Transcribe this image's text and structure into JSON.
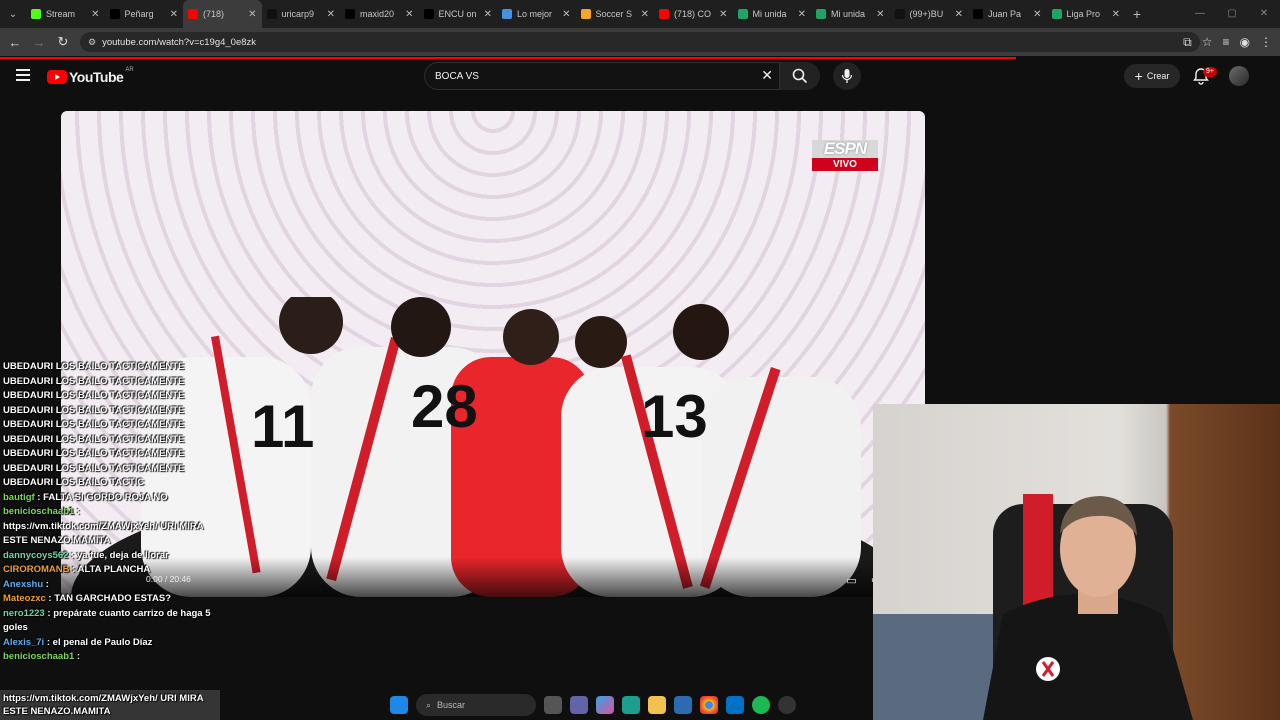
{
  "browser": {
    "tabs": [
      {
        "label": "Stream",
        "icon": "kick-icon",
        "color": "#53fc18"
      },
      {
        "label": "Peñarg",
        "icon": "x-icon",
        "color": "#000000"
      },
      {
        "label": "(718)",
        "icon": "youtube-icon",
        "color": "#ff0000",
        "active": true
      },
      {
        "label": "uricarp9",
        "icon": "tiktok-icon",
        "color": "#111111"
      },
      {
        "label": "maxid20",
        "icon": "x-icon",
        "color": "#000000"
      },
      {
        "label": "ENCU on",
        "icon": "x-icon",
        "color": "#000000"
      },
      {
        "label": "Lo mejor",
        "icon": "bookmark-icon",
        "color": "#4a90e2"
      },
      {
        "label": "Soccer S",
        "icon": "soccer-icon",
        "color": "#f5a623"
      },
      {
        "label": "(718) CO",
        "icon": "youtube-icon",
        "color": "#ff0000"
      },
      {
        "label": "Mi unida",
        "icon": "drive-icon",
        "color": "#1fa463"
      },
      {
        "label": "Mi unida",
        "icon": "drive-icon",
        "color": "#1fa463"
      },
      {
        "label": "(99+)BU",
        "icon": "tiktok-icon",
        "color": "#111111"
      },
      {
        "label": "Juan Pa",
        "icon": "x-icon",
        "color": "#000000"
      },
      {
        "label": "Liga Pro",
        "icon": "globe-icon",
        "color": "#1fa463"
      }
    ],
    "url": "youtube.com/watch?v=c19g4_0e8zk"
  },
  "youtube": {
    "logo_text": "YouTube",
    "country_code": "AR",
    "search_query": "BOCA VS",
    "create_label": "Crear",
    "notification_badge": "9+"
  },
  "video": {
    "channel_logo_text": "ESPN",
    "live_label": "VIVO",
    "time": "0:00 / 20:46"
  },
  "chat": {
    "spam_lines": [
      "UBEDAURI LOS BAILO TACTICAMENTE",
      "UBEDAURI LOS BAILO TACTICAMENTE",
      "UBEDAURI LOS BAILO TACTICAMENTE",
      "UBEDAURI LOS BAILO TACTICAMENTE",
      "UBEDAURI LOS BAILO TACTICAMENTE",
      "UBEDAURI LOS BAILO TACTICAMENTE",
      "UBEDAURI LOS BAILO TACTICAMENTE",
      "UBEDAURI LOS BAILO TACTICAMENTE",
      "UBEDAURI LOS BAILO TACTIC"
    ],
    "messages": [
      {
        "user": "bautigf",
        "color": "#7cd957",
        "text": "FALTA SI GORDO ROJA NO"
      },
      {
        "user": "benicioschaab1",
        "color": "#7cd957",
        "text": "https://vm.tiktok.com/ZMAWjxYeh/ URI MIRA ESTE NENAZO.MAMITA"
      },
      {
        "user": "dannycoys562",
        "color": "#6fd6a0",
        "text": "ya fue, deja de llorar"
      },
      {
        "user": "CIROROMANB",
        "color": "#f0a030",
        "text": "ALTA PLANCHA"
      },
      {
        "user": "Anexshu",
        "color": "#5ab0f0",
        "text": ""
      },
      {
        "user": "Mateozxc",
        "color": "#f0a030",
        "text": "TAN GARCHADO ESTAS?"
      },
      {
        "user": "nero1223",
        "color": "#6fd6a0",
        "text": "prepárate cuanto carrizo de haga 5 goles"
      },
      {
        "user": "Alexis_7i",
        "color": "#5ab0f0",
        "text": "el penal de Paulo Díaz"
      },
      {
        "user": "benicioschaab1",
        "color": "#7cd957",
        "text": ""
      }
    ],
    "last_message": "https://vm.tiktok.com/ZMAWjxYeh/ URI MIRA ESTE NENAZO.MAMITA"
  },
  "taskbar": {
    "search_placeholder": "Buscar"
  }
}
